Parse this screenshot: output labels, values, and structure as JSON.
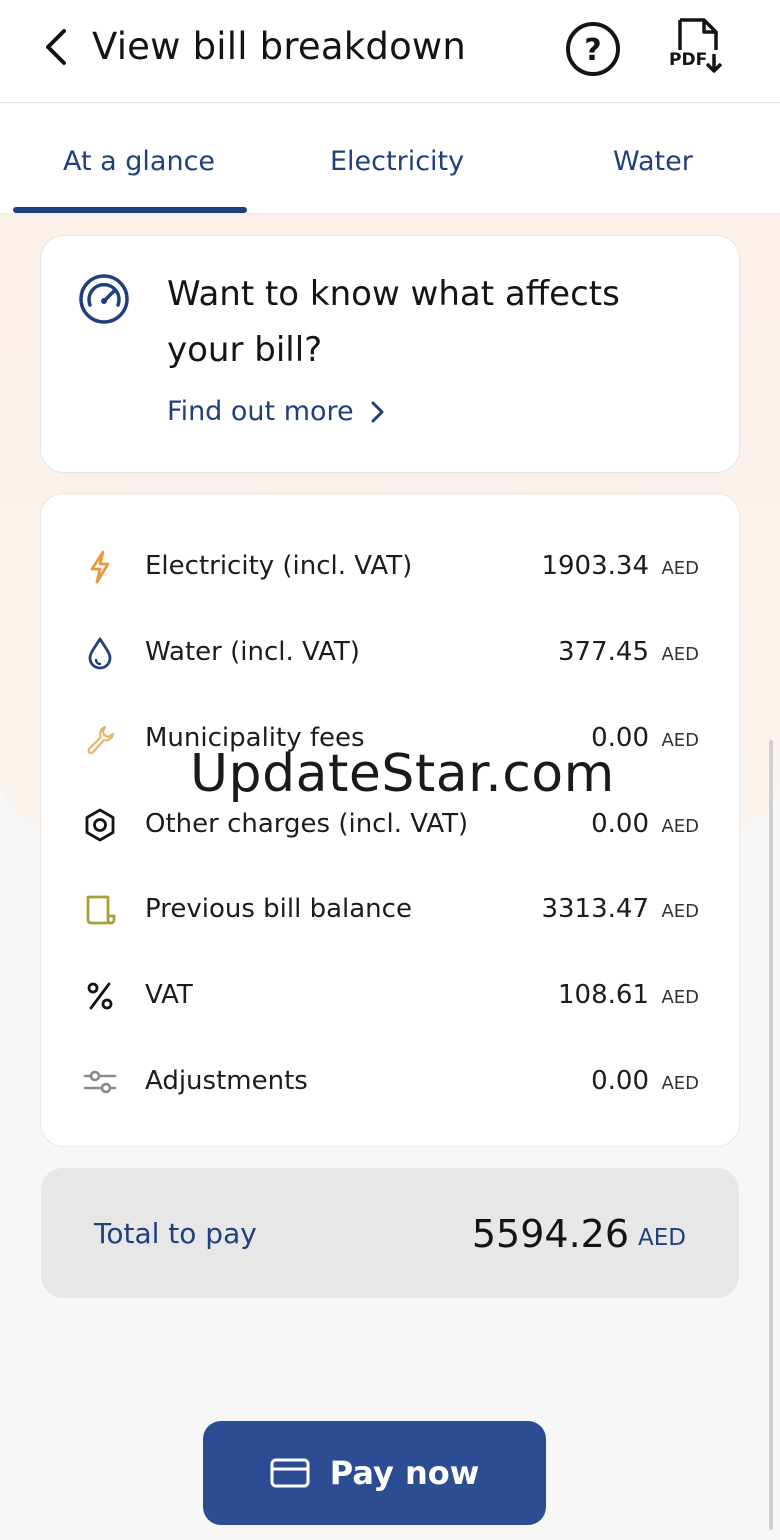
{
  "header": {
    "title": "View bill breakdown",
    "pdf_label": "PDF"
  },
  "tabs": [
    {
      "label": "At a glance",
      "active": true
    },
    {
      "label": "Electricity",
      "active": false
    },
    {
      "label": "Water",
      "active": false
    }
  ],
  "info_card": {
    "title": "Want to know what affects your bill?",
    "link_label": "Find out more"
  },
  "breakdown": {
    "currency": "AED",
    "rows": [
      {
        "label": "Electricity (incl. VAT)",
        "amount": "1903.34",
        "icon": "lightning-icon"
      },
      {
        "label": "Water (incl. VAT)",
        "amount": "377.45",
        "icon": "water-drop-icon"
      },
      {
        "label": "Municipality fees",
        "amount": "0.00",
        "icon": "wrench-icon"
      },
      {
        "label": "Other charges (incl. VAT)",
        "amount": "0.00",
        "icon": "hex-nut-icon"
      },
      {
        "label": "Previous bill balance",
        "amount": "3313.47",
        "icon": "receipt-icon"
      },
      {
        "label": "VAT",
        "amount": "108.61",
        "icon": "percent-icon"
      },
      {
        "label": "Adjustments",
        "amount": "0.00",
        "icon": "sliders-icon"
      }
    ]
  },
  "total": {
    "label": "Total to pay",
    "amount": "5594.26",
    "currency": "AED"
  },
  "watermark": "UpdateStar.com",
  "pay_button": {
    "label": "Pay now"
  },
  "colors": {
    "brand_blue": "#1f3f7e",
    "button_blue": "#2c4d94",
    "electricity_orange": "#e89a3c",
    "receipt_olive": "#a8a03a"
  }
}
